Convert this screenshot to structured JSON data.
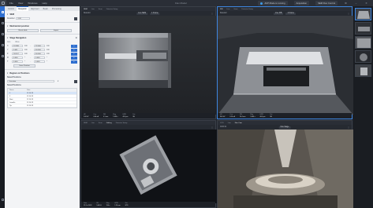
{
  "app": {
    "title": "Flex Model",
    "menu": [
      "File",
      "View",
      "Windows",
      "Help"
    ],
    "status_running": "AFP Mode is running",
    "status_second": "Acquisition",
    "status_third": "SEM Flex Control"
  },
  "nav": [
    "Stage Navigation",
    "Log"
  ],
  "panel": {
    "tabs": [
      "Control",
      "Navigation",
      "Alignment",
      "Beam",
      "Processing"
    ],
    "sec_top": {
      "label": "SEM",
      "field": "Retarded",
      "value": "0.00"
    },
    "sec_mechanical": {
      "label": "Mechanical position",
      "left_btn": "Reset table",
      "right_btn": "Import"
    },
    "stage": {
      "label": "Stage Navigation",
      "col_a": "Axis",
      "col_b": "Value",
      "rows": [
        {
          "axis": "X",
          "value": "12.398",
          "unit": "mm",
          "target": "22.000",
          "tunit": "mm"
        },
        {
          "axis": "Y",
          "value": "0.451",
          "unit": "mm",
          "target": "40.000",
          "tunit": "mm"
        },
        {
          "axis": "Z",
          "value": "18.207",
          "unit": "mm",
          "target": "40.000",
          "tunit": "mm"
        },
        {
          "axis": "R",
          "value": "0.000",
          "unit": "°",
          "target": "0.000",
          "tunit": "°"
        },
        {
          "axis": "T",
          "value": "0.000",
          "unit": "°",
          "target": "0.000",
          "tunit": "°"
        }
      ],
      "save_btn": "Save Position"
    },
    "regions": {
      "label": "Regions & Positions",
      "sub1": "Saved Positions",
      "select": "Overview",
      "sub2": "Saved Positions",
      "headers": [
        "Name",
        "Date"
      ],
      "rows": [
        {
          "name": "1",
          "date": "12.10.23"
        },
        {
          "name": "2",
          "date": "12.10.23"
        },
        {
          "name": "Start",
          "date": "12.10.23"
        },
        {
          "name": "Lamella",
          "date": "12.10.23"
        },
        {
          "name": "Tip",
          "date": "12.10.23"
        }
      ]
    }
  },
  "views": [
    {
      "tabs": [
        "SEM",
        "Live",
        "Scan",
        "Detector Setup"
      ],
      "tool_left": "Detector",
      "tool_mid": "Live SEM",
      "tool_mid2": "1 Frame",
      "status": [
        [
          "HV",
          "5.00 kV"
        ],
        [
          "Curr",
          "0.40 nA"
        ],
        [
          "WD",
          "4.1 mm"
        ],
        [
          "Mag",
          "5 000 x"
        ],
        [
          "HFW",
          "40.0 µm"
        ],
        [
          "Det",
          "SE"
        ]
      ]
    },
    {
      "tabs": [
        "FIB",
        "Live",
        "Scan",
        "Detector Setup"
      ],
      "tool_left": "Detector",
      "tool_mid": "Live FIB",
      "tool_mid2": "1 Frame",
      "status": [
        [
          "HV",
          "30.0 kV"
        ],
        [
          "Curr",
          "0.10 nA"
        ],
        [
          "WD",
          "16.4 mm"
        ],
        [
          "Mag",
          "5 000 x"
        ],
        [
          "HFW",
          "40.0 µm"
        ],
        [
          "Det",
          "SE"
        ]
      ]
    },
    {
      "tabs": [
        "SEM",
        "Live",
        "Scan",
        "Gallery",
        "Detector Setup"
      ],
      "tool_left": "",
      "tool_mid": "",
      "tool_mid2": "",
      "status": [
        [
          "Date",
          "12 Oct 2023"
        ],
        [
          "HV",
          "5.00 kV"
        ],
        [
          "Mag",
          "150 x"
        ],
        [
          "HFW",
          "1.20 mm"
        ],
        [
          "Det",
          "ETD"
        ]
      ]
    },
    {
      "tabs": [
        "CCD",
        "Live",
        "Nav Cam"
      ],
      "tool_left": "CCD 01",
      "tool_mid": "Nav Stage",
      "tool_mid2": "",
      "status": []
    }
  ]
}
